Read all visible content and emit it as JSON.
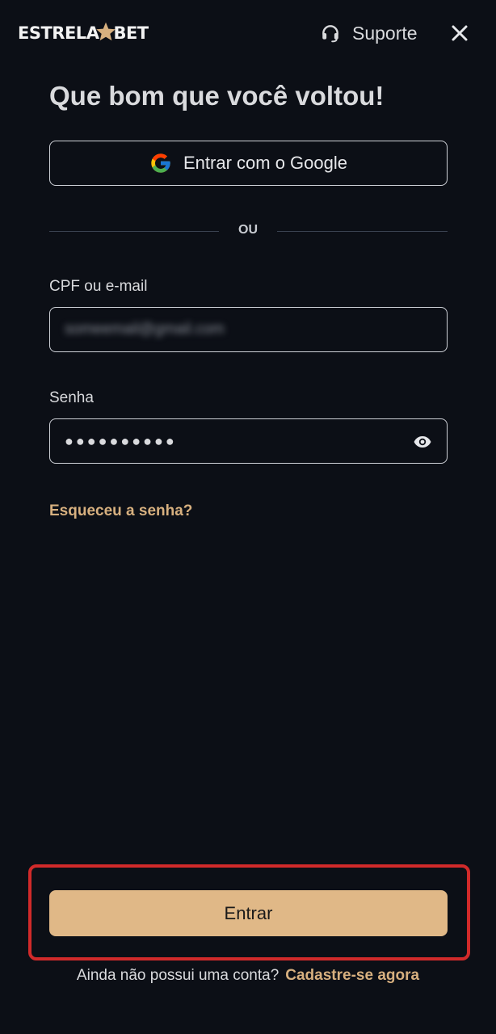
{
  "header": {
    "logo_left": "ESTRELA",
    "logo_right": "BET",
    "support_label": "Suporte",
    "star_color": "#d7b07f",
    "icons": {
      "support": "headset-icon",
      "close": "close-icon"
    }
  },
  "login": {
    "title": "Que bom que você voltou!",
    "google_button_label": "Entrar com o Google",
    "divider_text": "OU",
    "email_label": "CPF ou e-mail",
    "email_value": "someemail@gmail.com",
    "password_label": "Senha",
    "password_mask": "●●●●●●●●●●",
    "forgot_password_label": "Esqueceu a senha?",
    "submit_label": "Entrar",
    "signup_prompt": "Ainda não possui uma conta?",
    "signup_link": "Cadastre-se agora"
  },
  "colors": {
    "background": "#0c0f16",
    "accent": "#e0b887",
    "link": "#d7b07f",
    "highlight": "#d12a2a"
  }
}
